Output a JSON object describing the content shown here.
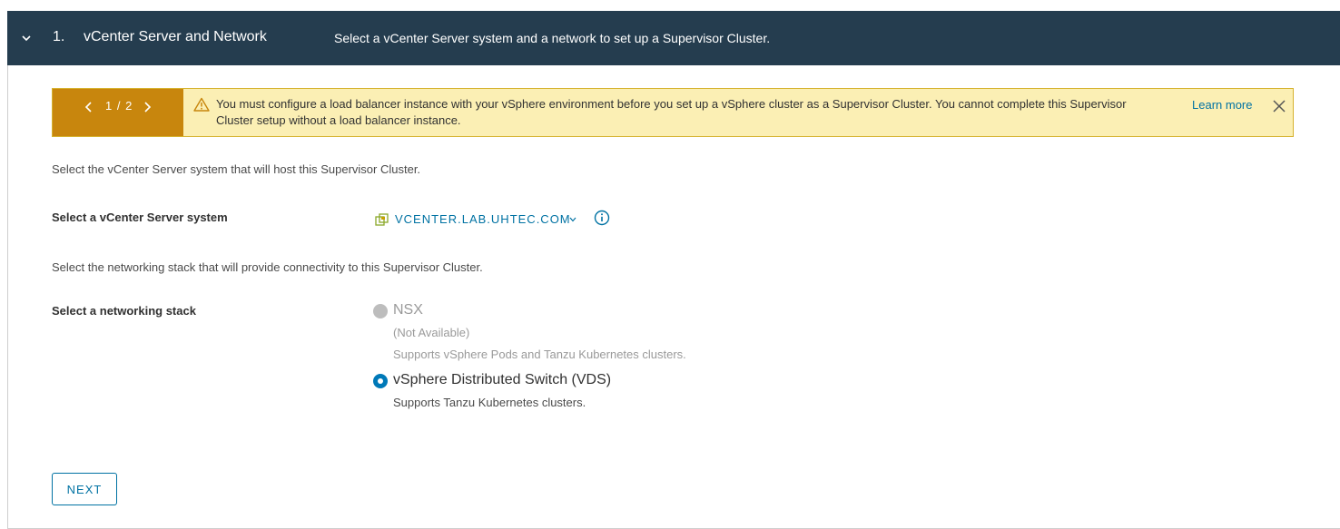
{
  "section": {
    "step_number": "1.",
    "title": "vCenter Server and Network",
    "description": "Select a vCenter Server system and a network to set up a Supervisor Cluster."
  },
  "alert": {
    "pager": "1 / 2",
    "message": "You must configure a load balancer instance with your vSphere environment before you set up a vSphere cluster as a Supervisor Cluster. You cannot complete this Supervisor Cluster setup without a load balancer instance.",
    "learn_more": "Learn more"
  },
  "vcenter": {
    "intro": "Select the vCenter Server system that will host this Supervisor Cluster.",
    "label": "Select a vCenter Server system",
    "selected": "VCENTER.LAB.UHTEC.COM"
  },
  "network": {
    "intro": "Select the networking stack that will provide connectivity to this Supervisor Cluster.",
    "label": "Select a networking stack",
    "options": [
      {
        "title": "NSX",
        "status": "(Not Available)",
        "description": "Supports vSphere Pods and Tanzu Kubernetes clusters.",
        "selected": false,
        "disabled": true
      },
      {
        "title": "vSphere Distributed Switch (VDS)",
        "description": "Supports Tanzu Kubernetes clusters.",
        "selected": true,
        "disabled": false
      }
    ]
  },
  "actions": {
    "next": "NEXT"
  },
  "colors": {
    "header_bg": "#253d4f",
    "alert_bg": "#fbefb4",
    "alert_pager_bg": "#c8860d",
    "link": "#0072a3",
    "radio_selected": "#0079b8"
  },
  "icons": [
    "chevron-down-icon",
    "chevron-left-icon",
    "chevron-right-icon",
    "warning-icon",
    "close-icon",
    "vcenter-icon",
    "info-icon"
  ]
}
